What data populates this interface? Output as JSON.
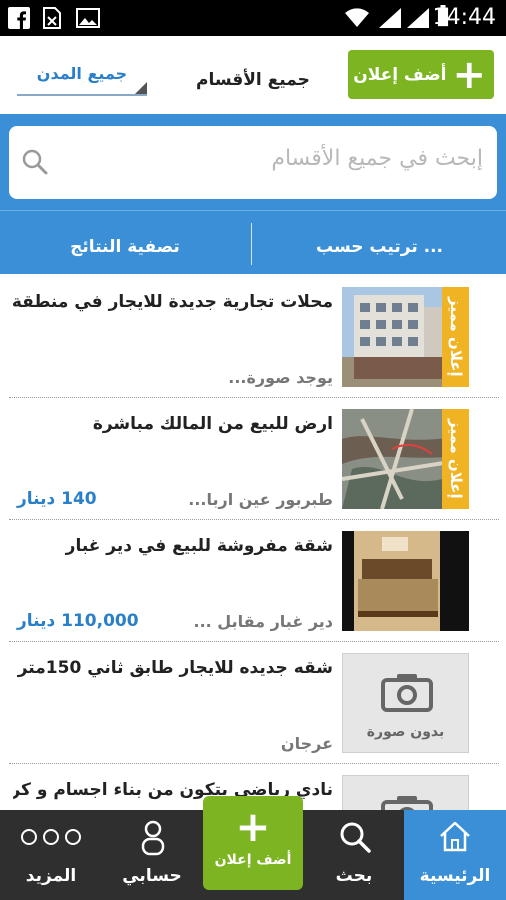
{
  "status_bar": {
    "time": "14:44"
  },
  "header": {
    "add_button_label": "أضف إعلان",
    "categories_label": "جميع الأقسام",
    "cities_label": "جميع المدن"
  },
  "search": {
    "placeholder": "إبحث في جميع الأقسام"
  },
  "toolbar": {
    "sort_label": "ترتيب حسب ...",
    "filter_label": "تصفية النتائج"
  },
  "listings": [
    {
      "title": "محلات تجارية جديدة للايجار في منطقة...",
      "location": "يوجد صورة...",
      "price": "",
      "featured": "إعلان مميز",
      "image": "building"
    },
    {
      "title": "ارض للبيع من المالك مباشرة",
      "location": "طبربور عين اربا...",
      "price": "140 دينار",
      "featured": "إعلان مميز",
      "image": "map"
    },
    {
      "title": "شقة مفروشة للبيع في دير غبار",
      "location": "دير غبار مقابل ...",
      "price": "110,000 دينار",
      "featured": "",
      "image": "bedroom"
    },
    {
      "title": "شقه جديده للايجار طابق ثاني 150متر",
      "location": "عرجان",
      "price": "",
      "featured": "",
      "image": "none",
      "no_image_label": "بدون صورة"
    },
    {
      "title": "نادي رياضي يتكون من بناء اجسام و كر...",
      "location": "",
      "price": "",
      "featured": "",
      "image": "none",
      "no_image_label": ""
    }
  ],
  "bottom_nav": {
    "more_label": "المزيد",
    "account_label": "حسابي",
    "add_label": "أضف إعلان",
    "search_label": "بحث",
    "home_label": "الرئيسية"
  },
  "colors": {
    "primary": "#3a8fd6",
    "accent_green": "#7cb521",
    "featured": "#f0b323",
    "price": "#2a7fc9",
    "nav_bg": "#2f2f2f"
  }
}
